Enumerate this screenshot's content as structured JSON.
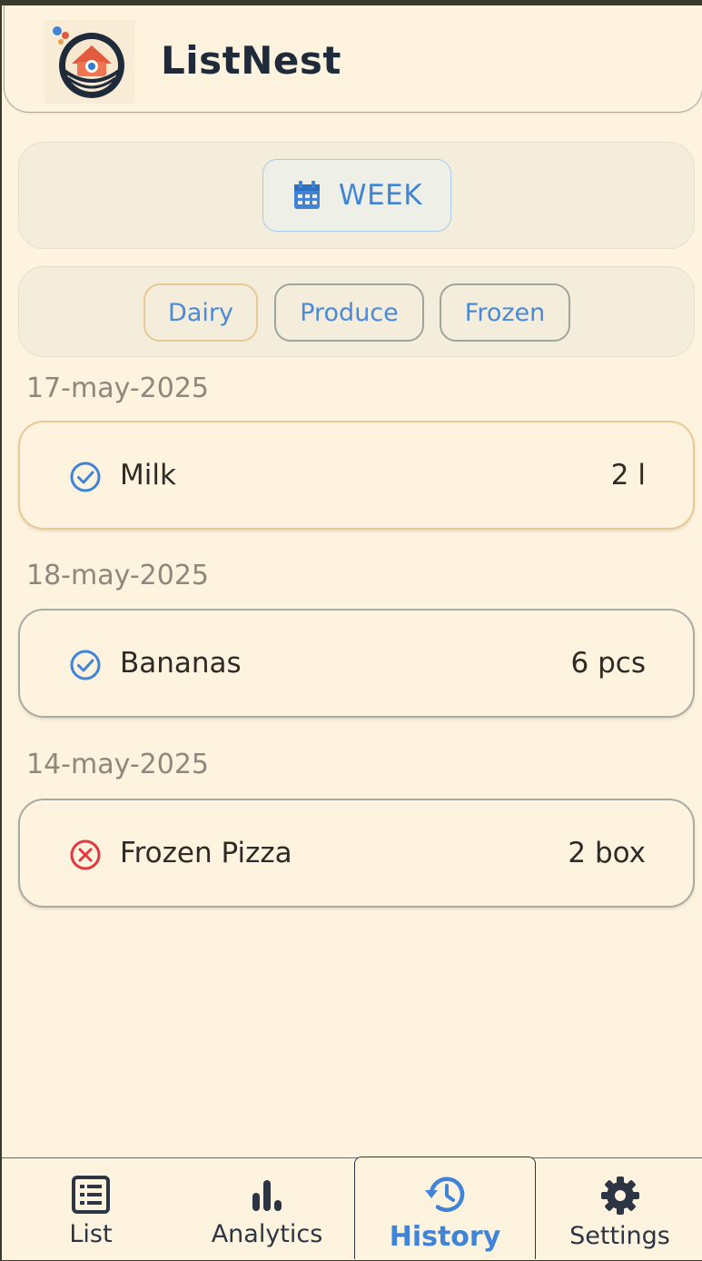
{
  "app": {
    "title": "ListNest"
  },
  "filters": {
    "period_label": "WEEK",
    "categories": [
      {
        "label": "Dairy",
        "color": "#e8c893"
      },
      {
        "label": "Produce",
        "color": "#9ea69c"
      },
      {
        "label": "Frozen",
        "color": "#9ea69c"
      }
    ]
  },
  "history": [
    {
      "date": "17-may-2025",
      "item": "Milk",
      "quantity": "2 l",
      "status": "completed",
      "category": "Dairy"
    },
    {
      "date": "18-may-2025",
      "item": "Bananas",
      "quantity": "6 pcs",
      "status": "completed",
      "category": "Produce"
    },
    {
      "date": "14-may-2025",
      "item": "Frozen Pizza",
      "quantity": "2 box",
      "status": "cancelled",
      "category": "Frozen"
    }
  ],
  "nav": {
    "items": [
      {
        "label": "List",
        "icon": "list-icon"
      },
      {
        "label": "Analytics",
        "icon": "bar-chart-icon"
      },
      {
        "label": "History",
        "icon": "history-icon",
        "active": true
      },
      {
        "label": "Settings",
        "icon": "gear-icon"
      }
    ]
  },
  "colors": {
    "accent": "#3f84d6",
    "background": "#fdf3df",
    "completed": "#3f84d6",
    "cancelled": "#e0383e",
    "dairy_border": "#e8c893"
  }
}
